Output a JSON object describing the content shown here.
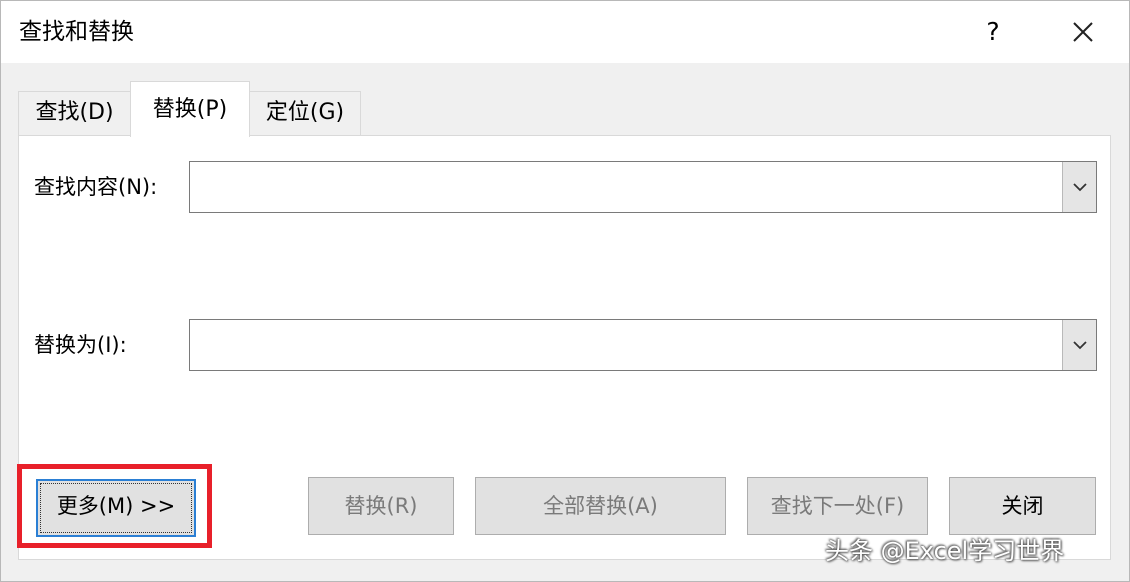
{
  "window": {
    "title": "查找和替换",
    "help_label": "?",
    "close_icon": "close-icon"
  },
  "tabs": [
    {
      "label": "查找(D)",
      "selected": false
    },
    {
      "label": "替换(P)",
      "selected": true
    },
    {
      "label": "定位(G)",
      "selected": false
    }
  ],
  "find": {
    "label": "查找内容(N):",
    "value": "",
    "placeholder": ""
  },
  "replace": {
    "label": "替换为(I):",
    "value": "",
    "placeholder": ""
  },
  "buttons": {
    "more": "更多(M) >>",
    "replace": "替换(R)",
    "replace_all": "全部替换(A)",
    "find_next": "查找下一处(F)",
    "close": "关闭"
  },
  "highlight_color": "#e8202a",
  "focus_color": "#2b7fd4",
  "watermark": "头条 @Excel学习世界"
}
